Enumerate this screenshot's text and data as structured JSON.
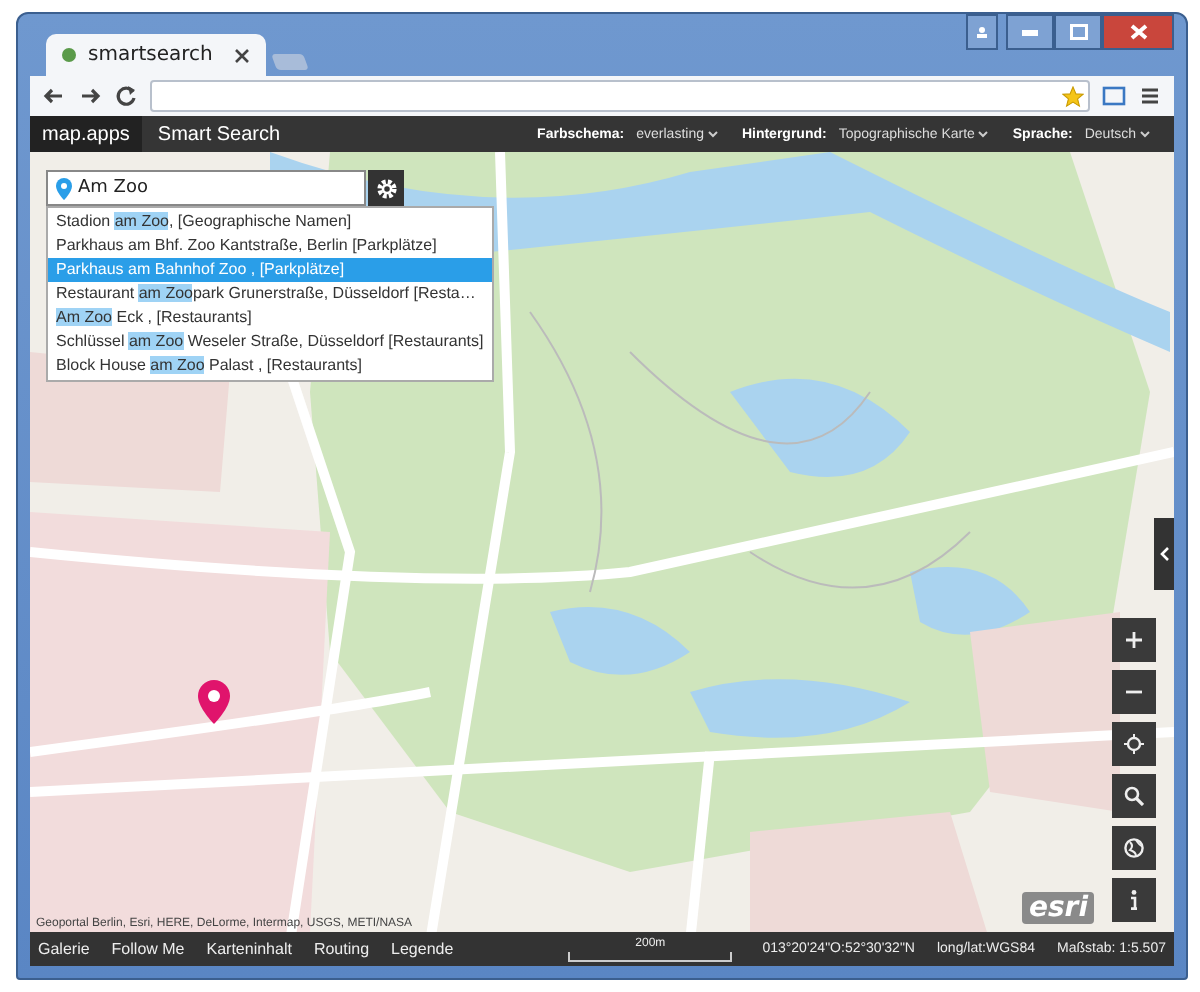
{
  "browser": {
    "tab": {
      "title": "smartsearch",
      "selected": true
    }
  },
  "app_bar": {
    "brand": "map.apps",
    "title": "Smart Search",
    "settings": [
      {
        "label": "Farbschema:",
        "value": "everlasting"
      },
      {
        "label": "Hintergrund:",
        "value": "Topographische Karte"
      },
      {
        "label": "Sprache:",
        "value": "Deutsch"
      }
    ]
  },
  "search": {
    "value": "Am Zoo",
    "suggestions": [
      {
        "selected": false,
        "segments": [
          {
            "text": "Stadion ",
            "match": false
          },
          {
            "text": "am Zoo",
            "match": true
          },
          {
            "text": ", [Geographische Namen]",
            "match": false
          }
        ]
      },
      {
        "selected": false,
        "segments": [
          {
            "text": "Parkhaus am Bhf. Zoo Kantstraße, Berlin [Parkplätze]",
            "match": false
          }
        ]
      },
      {
        "selected": true,
        "segments": [
          {
            "text": "Parkhaus am Bahnhof Zoo , [Parkplätze]",
            "match": false
          }
        ]
      },
      {
        "selected": false,
        "segments": [
          {
            "text": "Restaurant ",
            "match": false
          },
          {
            "text": "am Zoo",
            "match": true
          },
          {
            "text": "park Grunerstraße, Düsseldorf [Resta…",
            "match": false
          }
        ]
      },
      {
        "selected": false,
        "segments": [
          {
            "text": "Am Zoo",
            "match": true
          },
          {
            "text": " Eck , [Restaurants]",
            "match": false
          }
        ]
      },
      {
        "selected": false,
        "segments": [
          {
            "text": "Schlüssel ",
            "match": false
          },
          {
            "text": "am Zoo",
            "match": true
          },
          {
            "text": " Weseler Straße, Düsseldorf [Restaurants]",
            "match": false
          }
        ]
      },
      {
        "selected": false,
        "segments": [
          {
            "text": "Block House ",
            "match": false
          },
          {
            "text": "am Zoo",
            "match": true
          },
          {
            "text": " Palast , [Restaurants]",
            "match": false
          }
        ]
      }
    ]
  },
  "map": {
    "logo": "esri",
    "attribution": "Geoportal Berlin, Esri, HERE, DeLorme, Intermap, USGS, METI/NASA"
  },
  "footer": {
    "tools": [
      "Galerie",
      "Follow Me",
      "Karteninhalt",
      "Routing",
      "Legende"
    ],
    "scale": "200m",
    "coordinates": "013°20'24\"O:52°30'32\"N",
    "crs": "long/lat:WGS84",
    "ratio": "Maßstab: 1:5.507"
  }
}
